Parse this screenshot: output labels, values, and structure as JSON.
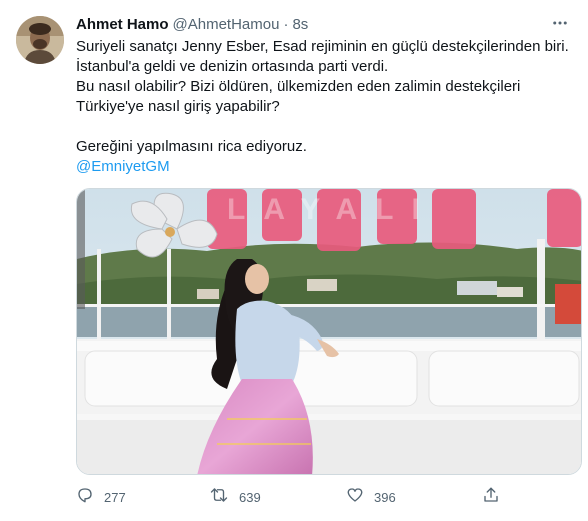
{
  "author": {
    "display_name": "Ahmet Hamo",
    "handle": "@AhmetHamou",
    "separator": "·",
    "time": "8s"
  },
  "tweet": {
    "lines": [
      "Suriyeli sanatçı Jenny Esber, Esad rejiminin en güçlü destekçilerinden biri.",
      "İstanbul'a geldi ve denizin ortasında parti verdi.",
      "Bu nasıl olabilir? Bizi öldüren, ülkemizden eden zalimin destekçileri",
      "Türkiye'ye nasıl giriş yapabilir?",
      "",
      "Gereğini yapılmasını rica ediyoruz."
    ],
    "mention": "@EmniyetGM",
    "photo_sign_text": "LAYALI"
  },
  "stats": {
    "replies": "277",
    "retweets": "639",
    "likes": "396"
  },
  "icons": {
    "more": "more-horizontal-icon",
    "reply": "reply-icon",
    "retweet": "retweet-icon",
    "like": "heart-icon",
    "share": "share-icon"
  },
  "colors": {
    "link": "#1d9bf0",
    "secondary_text": "#536471",
    "primary_text": "#0f1419"
  }
}
